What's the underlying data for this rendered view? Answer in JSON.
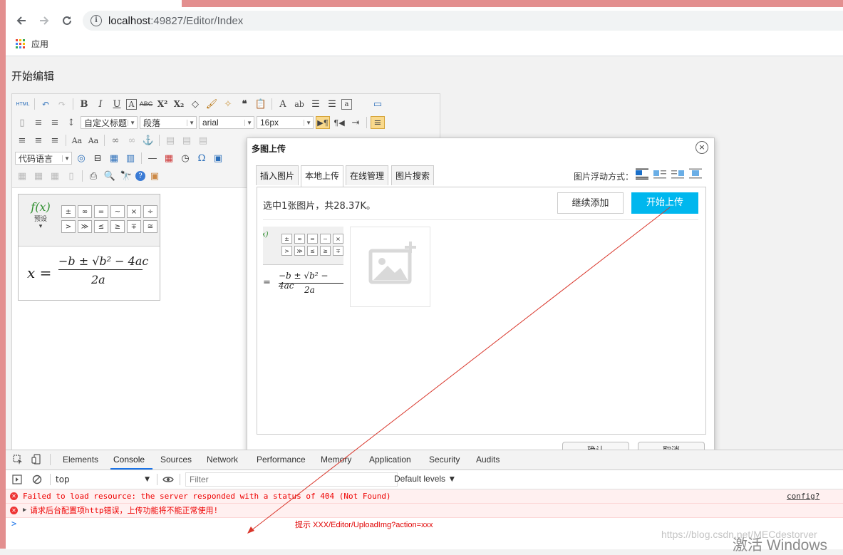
{
  "browser": {
    "url_host": "localhost",
    "url_path": ":49827/Editor/Index",
    "bookmark_label": "应用"
  },
  "page": {
    "title": "开始编辑"
  },
  "editor": {
    "html_button": "HTML",
    "custom_heading": "自定义标题",
    "paragraph": "段落",
    "font_family": "arial",
    "font_size": "16px",
    "code_language": "代码语言"
  },
  "formula": {
    "preset_label": "预设",
    "fx": "f(x)",
    "symbols_row1": [
      "±",
      "∞",
      "=",
      "~",
      "×",
      "÷"
    ],
    "symbols_row2": [
      ">",
      "≫",
      "≤",
      "≥",
      "∓",
      "≅"
    ]
  },
  "dialog": {
    "title": "多图上传",
    "tabs": [
      "插入图片",
      "本地上传",
      "在线管理",
      "图片搜索"
    ],
    "float_label": "图片浮动方式：",
    "upload_info": "选中1张图片，共28.37K。",
    "continue_button": "继续添加",
    "start_button": "开始上传",
    "ok_button": "确认",
    "cancel_button": "取消"
  },
  "devtools": {
    "tabs": [
      "Elements",
      "Console",
      "Sources",
      "Network",
      "Performance",
      "Memory",
      "Application",
      "Security",
      "Audits"
    ],
    "context": "top",
    "filter_placeholder": "Filter",
    "levels": "Default levels ▼",
    "error1": "Failed to load resource: the server responded with a status of 404 (Not Found)",
    "error1_source": "config?&noCa",
    "error2": "请求后台配置项http错误，上传功能将不能正常使用!",
    "prompt": ">"
  },
  "annotation": {
    "text": "提示  XXX/Editor/UploadImg?action=xxx"
  },
  "watermarks": {
    "blog": "https://blog.csdn.net/MECdestorver",
    "windows": "激活 Windows"
  },
  "colors": {
    "accent": "#00b7ee",
    "error": "#e00000",
    "window_edge": "#e38f8f"
  }
}
